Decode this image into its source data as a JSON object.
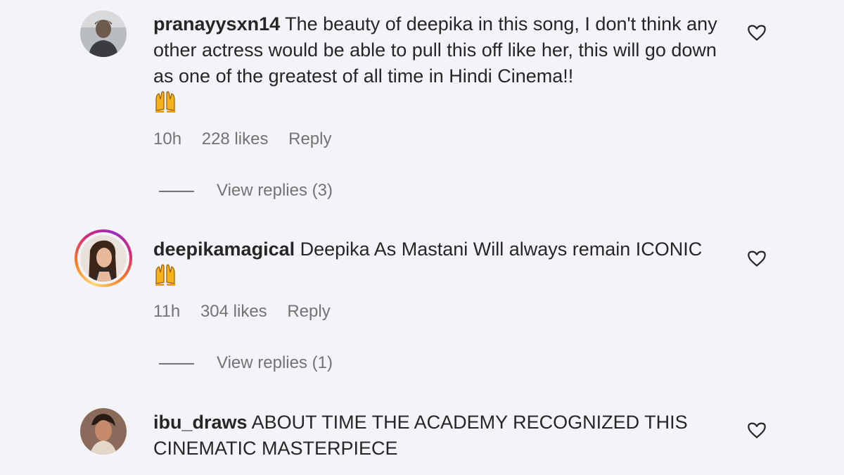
{
  "comments": [
    {
      "username": "pranayysxn14",
      "text": "The beauty of deepika in this song, I don't think any other actress would be able to pull this off like her, this will go down as one of the greatest of all time in Hindi Cinema!!",
      "emoji": "raised-hands",
      "time": "10h",
      "likes": "228 likes",
      "reply": "Reply",
      "view_replies": "View replies (3)",
      "avatar_icon": "user-avatar",
      "story_ring": false
    },
    {
      "username": "deepikamagical",
      "text": "Deepika As Mastani Will always remain ICONIC",
      "emoji": "raised-hands",
      "time": "11h",
      "likes": "304 likes",
      "reply": "Reply",
      "view_replies": "View replies (1)",
      "avatar_icon": "user-avatar",
      "story_ring": true
    },
    {
      "username": "ibu_draws",
      "text": "ABOUT TIME THE ACADEMY RECOGNIZED THIS CINEMATIC MASTERPIECE",
      "avatar_icon": "user-avatar",
      "story_ring": false
    }
  ],
  "colors": {
    "background": "#f4f4f8",
    "text": "#262626",
    "muted": "#737373",
    "story_gradient": [
      "#feda75",
      "#fa7e1e",
      "#d62976",
      "#962fbf"
    ]
  }
}
